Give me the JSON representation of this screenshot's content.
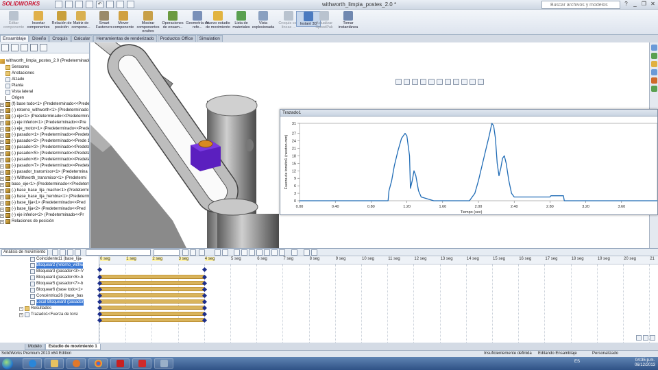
{
  "app": {
    "logo": "SOLIDWORKS",
    "doc_title": "withworth_limpia_postes_2.0 *",
    "search_placeholder": "Buscar archivos y modelos",
    "status_bar": {
      "edition": "SolidWorks Premium 2013 x64 Edition",
      "definition": "Insuficientemente definida",
      "mode": "Editando Ensamblaje",
      "custom": "Personalizado"
    }
  },
  "ribbon": [
    {
      "label": "Editar componente",
      "state": "grey",
      "icon": "edit-component-icon",
      "color": "#b9c3cf"
    },
    {
      "label": "Insertar componentes",
      "icon": "insert-components-icon",
      "color": "#e0b04a"
    },
    {
      "label": "Relación de posición",
      "icon": "mate-icon",
      "color": "#c9a03c"
    },
    {
      "label": "Matriz de compone...",
      "icon": "component-pattern-icon",
      "color": "#d9b050"
    },
    {
      "label": "Smart Fasteners",
      "icon": "smart-fasteners-icon",
      "color": "#9a8a6a"
    },
    {
      "label": "Mover componente",
      "icon": "move-component-icon",
      "color": "#d0a040"
    },
    {
      "label": "Mostrar componentes ocultos",
      "icon": "show-hidden-icon",
      "color": "#c8a048"
    },
    {
      "label": "Operaciones de ensam...",
      "icon": "assembly-features-icon",
      "color": "#6b9a40"
    },
    {
      "label": "Geometría de refe...",
      "icon": "reference-geometry-icon",
      "color": "#7a90b8"
    },
    {
      "label": "Nuevo estudio de movimiento",
      "icon": "motion-study-icon",
      "color": "#e2b440"
    },
    {
      "label": "Lista de materiales",
      "icon": "bom-icon",
      "color": "#5aa050"
    },
    {
      "label": "Vista explosionada",
      "icon": "exploded-view-icon",
      "color": "#8aa0c0"
    },
    {
      "label": "Croquis con líneas ...",
      "state": "grey",
      "icon": "explode-line-icon",
      "color": "#b9c3cf"
    },
    {
      "label": "Instant 3D",
      "state": "active",
      "icon": "instant3d-icon",
      "color": "#4a7ac0"
    },
    {
      "label": "Actualizar SpeedPak",
      "state": "grey",
      "icon": "speedpak-icon",
      "color": "#b9c3cf"
    },
    {
      "label": "Tomar instantánea",
      "icon": "snapshot-icon",
      "color": "#7088b0"
    }
  ],
  "tabs": [
    "Ensamblaje",
    "Diseño",
    "Croquis",
    "Calcular",
    "Herramientas de renderizado",
    "Productos Office",
    "Simulation"
  ],
  "tree": {
    "root": "withworth_limpia_postes_2.0  (Predeterminado",
    "items": [
      {
        "label": "Sensores",
        "icon": "folder"
      },
      {
        "label": "Anotaciones",
        "icon": "folder"
      },
      {
        "label": "Alzado",
        "icon": "plane"
      },
      {
        "label": "Planta",
        "icon": "plane"
      },
      {
        "label": "Vista lateral",
        "icon": "plane"
      },
      {
        "label": "Origen",
        "icon": "origin"
      },
      {
        "label": "(f) base todo<1> (Predeterminado<<Prede",
        "icon": "part",
        "exp": true
      },
      {
        "label": "(-) retorno_withworth<1> (Predeterminado",
        "icon": "part",
        "exp": true
      },
      {
        "label": "(-) eje<1> (Predeterminado<<Predetermina",
        "icon": "part",
        "exp": true
      },
      {
        "label": "(-) eje inferior<1> (Predeterminado<<Pre",
        "icon": "part",
        "exp": true
      },
      {
        "label": "(-) eje_motor<1> (Predeterminado<<Prede",
        "icon": "part",
        "exp": true
      },
      {
        "label": "(-) pasador<1> (Predeterminado<<Predete",
        "icon": "part",
        "exp": true
      },
      {
        "label": "(-) pasador<2> (Predeterminado<<Prede 1",
        "icon": "part",
        "exp": true
      },
      {
        "label": "(-) pasador<3> (Predeterminado<<Predete",
        "icon": "part",
        "exp": true
      },
      {
        "label": "(-) pasador<5> (Predeterminado<<Predete",
        "icon": "part",
        "exp": true
      },
      {
        "label": "(-) pasador<6> (Predeterminado<<Predete",
        "icon": "part",
        "exp": true
      },
      {
        "label": "(-) pasador<7> (Predeterminado<<Predete",
        "icon": "part",
        "exp": true
      },
      {
        "label": "(-) pasador_transmisor<1> (Predetermina",
        "icon": "part",
        "exp": true
      },
      {
        "label": "(-) Withworth_transmisor<1> (Predetermi",
        "icon": "part",
        "exp": true
      },
      {
        "label": "base_eje<1> (Predeterminado<<Predeterm",
        "icon": "part",
        "exp": true
      },
      {
        "label": "(-) base_base_lija_macho<1> (Predetermi",
        "icon": "part",
        "exp": true
      },
      {
        "label": "(-) base_base_lija_hembra<1> (Predeterm",
        "icon": "part",
        "exp": true
      },
      {
        "label": "(-) base_lija<1> (Predeterminado<<Pred",
        "icon": "part",
        "exp": true
      },
      {
        "label": "(-) base_lija<2> (Predeterminado<<Pred",
        "icon": "part",
        "exp": true
      },
      {
        "label": "(-) eje inferior<2> (Predeterminado<<Pr",
        "icon": "part",
        "exp": true
      },
      {
        "label": "Relaciones de posición",
        "icon": "mate",
        "exp": true
      }
    ]
  },
  "plot": {
    "window_title": "Trazado1",
    "chart_data": {
      "type": "line",
      "title": "",
      "xlabel": "Tiempo (sec)",
      "ylabel": "Fuerza de torsión1 (newton-mm)",
      "xlim": [
        0,
        4.0
      ],
      "ylim": [
        0,
        31
      ],
      "xticks": [
        "0.00",
        "0.40",
        "0.80",
        "1.20",
        "1.60",
        "2.00",
        "2.40",
        "2.80",
        "3.20",
        "3.60"
      ],
      "xtick_values": [
        0,
        0.4,
        0.8,
        1.2,
        1.6,
        2.0,
        2.4,
        2.8,
        3.2,
        3.6
      ],
      "yticks": [
        "0",
        "3",
        "6",
        "9",
        "12",
        "15",
        "18",
        "21",
        "24",
        "27",
        "31"
      ],
      "ytick_values": [
        0,
        3,
        6,
        9,
        12,
        15,
        18,
        21,
        24,
        27,
        31
      ],
      "grid": false,
      "color": "#1f6bb5",
      "x": [
        0.0,
        0.99,
        1.0,
        1.03,
        1.06,
        1.1,
        1.14,
        1.18,
        1.2,
        1.23,
        1.24,
        1.26,
        1.28,
        1.3,
        1.33,
        1.36,
        1.5,
        1.9,
        1.96,
        2.0,
        2.04,
        2.08,
        2.12,
        2.15,
        2.17,
        2.19,
        2.21,
        2.23,
        2.25,
        2.27,
        2.29,
        2.31,
        2.34,
        2.37,
        2.4,
        2.8,
        2.81,
        2.95,
        2.96,
        3.9,
        4.0
      ],
      "y": [
        0,
        0,
        4,
        8,
        14,
        20,
        25,
        27,
        26,
        18,
        5,
        8,
        12,
        10,
        4,
        1.5,
        0,
        0,
        3,
        8,
        14,
        20,
        26,
        31,
        30,
        25,
        15,
        10,
        13,
        17,
        18,
        15,
        8,
        3,
        1.5,
        1.5,
        2,
        2,
        0,
        0,
        0
      ]
    }
  },
  "motion": {
    "study_type": "Análisis de movimiento",
    "time_field": "",
    "items": [
      {
        "label": "Coincidente11 (base_lija-",
        "icon": "mate"
      },
      {
        "label": "Bloquear2 (retorno_withw",
        "icon": "lock",
        "sel": true
      },
      {
        "label": "Bloquear3 (pasador<3>-V",
        "icon": "lock"
      },
      {
        "label": "Bloquear4 (pasador<6>-b",
        "icon": "lock"
      },
      {
        "label": "Bloquear5 (pasador<7>-b",
        "icon": "lock"
      },
      {
        "label": "Bloquear6 (base todo<1>",
        "icon": "lock"
      },
      {
        "label": "Concéntrica26 (base_bas",
        "icon": "concentric"
      },
      {
        "label": "Local Bloquear8 (pasador",
        "icon": "lock",
        "sel": true
      },
      {
        "label": "Resultados",
        "icon": "folder",
        "exp": true
      },
      {
        "label": "Trazado1<Fuerza de torsi",
        "icon": "plot",
        "exp": true
      }
    ],
    "timeline_labels": [
      "0 seg",
      "1 seg",
      "2 seg",
      "3 seg",
      "4 seg",
      "5 seg",
      "6 seg",
      "7 seg",
      "8 seg",
      "9 seg",
      "10 seg",
      "11 seg",
      "12 seg",
      "13 seg",
      "14 seg",
      "15 seg",
      "16 seg",
      "17 seg",
      "18 seg",
      "19 seg",
      "20 seg",
      "21"
    ],
    "duration_s": 4
  },
  "bottom_tabs": [
    "Modelo",
    "Estudio de movimiento 1"
  ],
  "taskbar": {
    "lang": "ES",
    "time": "04:35 p.m.",
    "date": "06/12/2013"
  }
}
